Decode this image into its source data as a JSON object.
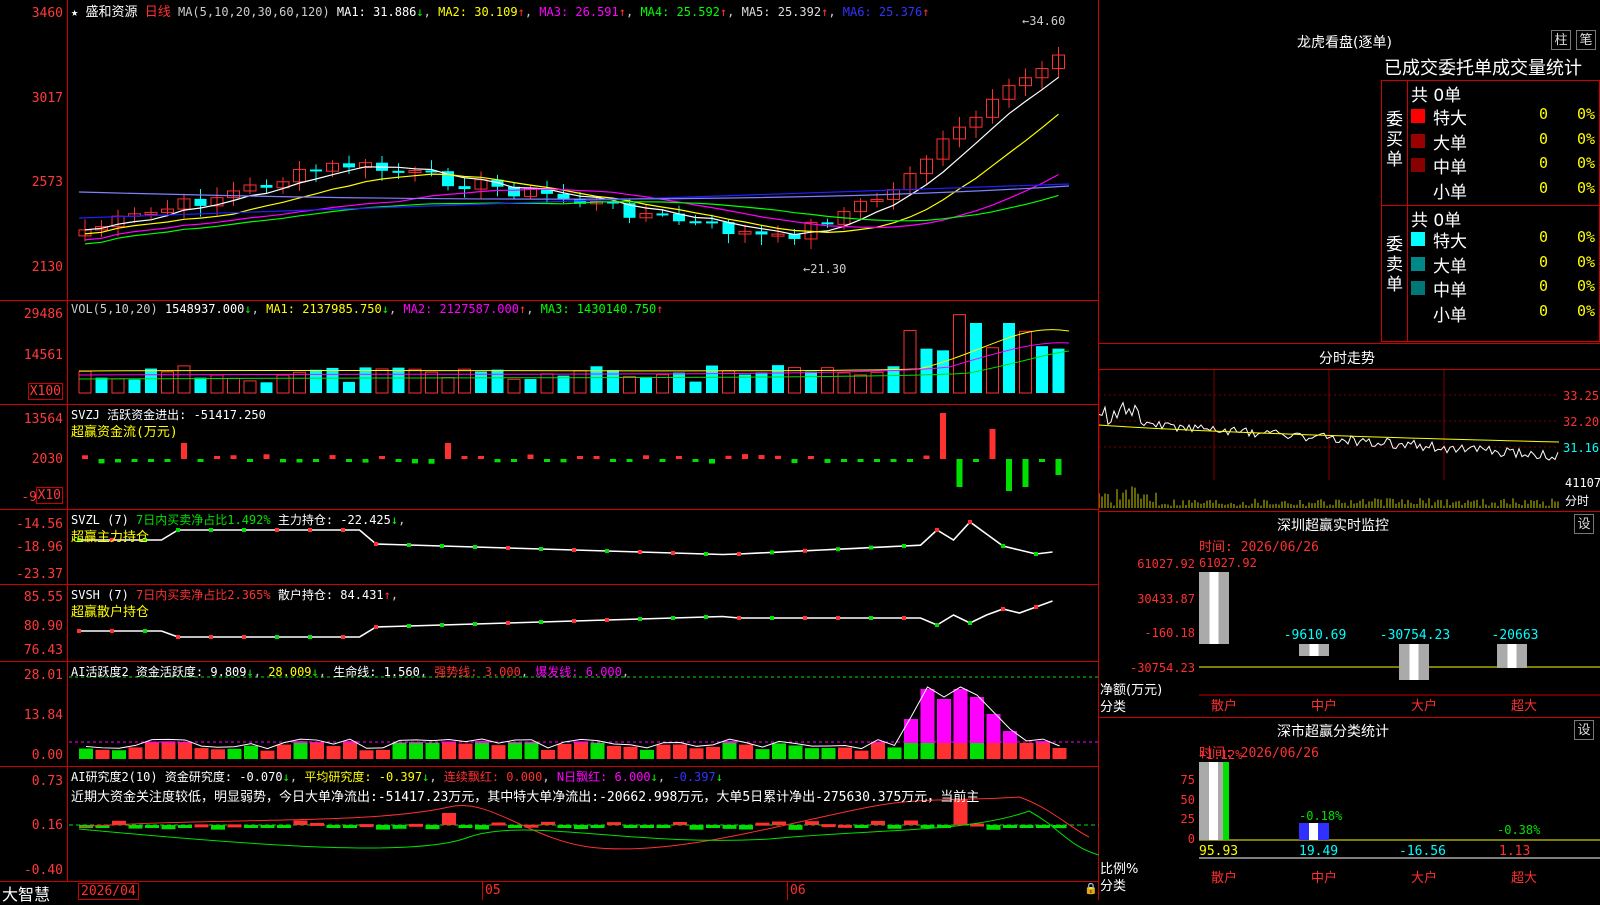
{
  "stock": {
    "name": "盛和资源",
    "period": "日线"
  },
  "ma_header": {
    "label": "MA(5,10,20,30,60,120)",
    "ma1": "MA1: 31.886",
    "ma2": "MA2: 30.109",
    "ma3": "MA3: 26.591",
    "ma4": "MA4: 25.592",
    "ma5": "MA5: 25.392",
    "ma6": "MA6: 25.376"
  },
  "price_axis": [
    "3460",
    "3017",
    "2573",
    "2130"
  ],
  "price_high": "←34.60",
  "price_low": "←21.30",
  "vol_header": {
    "label": "VOL(5,10,20)",
    "value": "1548937.000",
    "ma1": "MA1: 2137985.750",
    "ma2": "MA2: 2127587.000",
    "ma3": "MA3: 1430140.750"
  },
  "vol_axis": [
    "29486",
    "14561"
  ],
  "vol_unit": "X100",
  "svzj": {
    "label": "SVZJ  活跃资金进出: -51417.250",
    "sub": "超赢资金流(万元)",
    "axis": [
      "13564",
      "2030",
      "-9"
    ],
    "unit": "X10"
  },
  "svzl": {
    "label": "SVZL (7)",
    "p1": "7日内买卖净占比1.492%",
    "p2": "主力持仓: -22.425",
    "sub": "超赢主力持仓",
    "axis": [
      "-14.56",
      "-18.96",
      "-23.37"
    ]
  },
  "svsh": {
    "label": "SVSH (7)",
    "p1": "7日内买卖净占比2.365%",
    "p2": "散户持仓: 84.431",
    "sub": "超赢散户持仓",
    "axis": [
      "85.55",
      "80.90",
      "76.43"
    ]
  },
  "ai1": {
    "label": "AI活跃度2",
    "t1": "资金活跃度: 9.809",
    "t2": "28.009",
    "t3": "生命线: 1.560",
    "t4": "强势线: 3.000",
    "t5": "爆发线: 6.000",
    "axis": [
      "28.01",
      "13.84",
      "0.00"
    ]
  },
  "ai2": {
    "label": "AI研究度2(10)",
    "t1": "资金研究度: -0.070",
    "t2": "平均研究度: -0.397",
    "t3": "连续飘红: 0.000",
    "t4": "N日飘红: 6.000",
    "t5": "-0.397",
    "axis": [
      "0.73",
      "0.16",
      "-0.40"
    ],
    "comment": "近期大资金关注度较低，明显弱势，今日大单净流出:-51417.23万元，其中特大单净流出:-20662.998万元，大单5日累计净出-275630.375万元，当前主"
  },
  "xaxis": {
    "brand": "大智慧",
    "d1": "2026/04",
    "d2": "05",
    "d3": "06"
  },
  "lhb": {
    "title": "龙虎看盘(逐单)",
    "btn1": "柱",
    "btn2": "笔",
    "tabs": "已成交委托单成交量统计",
    "buy_label": "委买单",
    "sell_label": "委卖单",
    "buy_total": "共 0单",
    "sell_total": "共 0单",
    "rows": [
      {
        "name": "特大",
        "v": "0",
        "p": "0%"
      },
      {
        "name": "大单",
        "v": "0",
        "p": "0%"
      },
      {
        "name": "中单",
        "v": "0",
        "p": "0%"
      },
      {
        "name": "小单",
        "v": "0",
        "p": "0%"
      }
    ]
  },
  "fenshi": {
    "title": "分时走势",
    "axis": [
      "33.25",
      "32.20",
      "31.16"
    ],
    "vol": "41107",
    "unit": "分时"
  },
  "szmon": {
    "title": "深圳超赢实时监控",
    "btn": "设",
    "time": "时间: 2026/06/26",
    "top": "61027.92",
    "axis": [
      "61027.92",
      "30433.87",
      "-160.18",
      "-30754.23"
    ],
    "ylabel": "净额(万元)",
    "xlabel": "分类",
    "cats": [
      "散户",
      "中户",
      "大户",
      "超大"
    ],
    "vals": [
      "-9610.69",
      "-30754.23",
      "-20663"
    ]
  },
  "szcls": {
    "title": "深市超赢分类统计",
    "btn": "设",
    "time": "时间: 2026/06/26",
    "axis": [
      "75",
      "50",
      "25",
      "0"
    ],
    "top": "+1.12%",
    "v2": "-0.18%",
    "v4": "-0.38%",
    "ylabel": "比例%",
    "xlabel": "分类",
    "bottom": [
      "95.93",
      "19.49",
      "-16.56",
      "1.13"
    ],
    "cats": [
      "散户",
      "中户",
      "大户",
      "超大"
    ]
  },
  "colors": {
    "up": "#ff3030",
    "down": "#00ffff",
    "ma1": "#ffffff",
    "ma2": "#ffff00",
    "ma3": "#ff00ff",
    "ma4": "#00ff00",
    "ma5": "#8080ff",
    "ma6": "#2020ff",
    "green": "#00e000",
    "axis": "#c00000"
  }
}
